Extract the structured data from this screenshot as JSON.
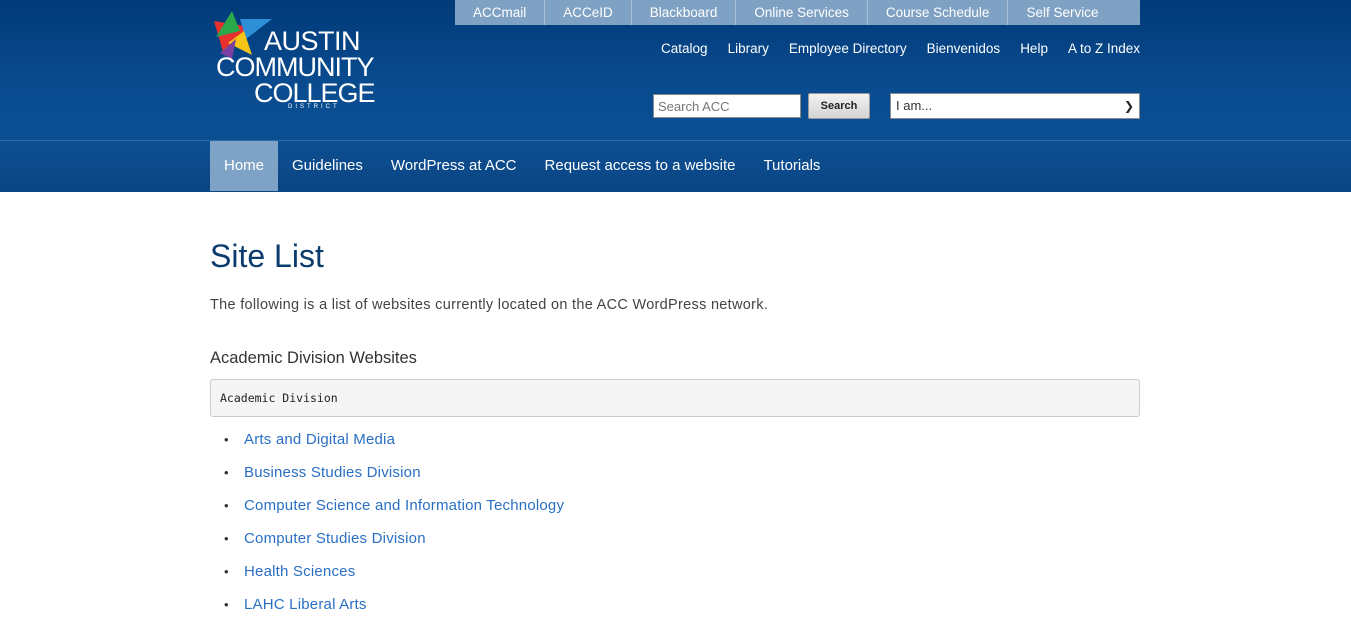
{
  "logo": {
    "line1": "AUSTIN",
    "line2": "COMMUNITY",
    "line3": "COLLEGE",
    "line4": "DISTRICT"
  },
  "utility_links": [
    "ACCmail",
    "ACCeID",
    "Blackboard",
    "Online Services",
    "Course Schedule",
    "Self Service"
  ],
  "secondary_links": [
    "Catalog",
    "Library",
    "Employee Directory",
    "Bienvenidos",
    "Help",
    "A to Z Index"
  ],
  "search": {
    "placeholder": "Search ACC",
    "button_label": "Search"
  },
  "audience_select": {
    "selected": "I am..."
  },
  "nav": {
    "items": [
      "Home",
      "Guidelines",
      "WordPress at ACC",
      "Request access to a website",
      "Tutorials"
    ],
    "active": "Home"
  },
  "main": {
    "title": "Site List",
    "intro": "The following is a list of websites currently located on the ACC WordPress network.",
    "section_heading": "Academic Division Websites",
    "code_box": "Academic Division",
    "sites": [
      "Arts and Digital Media",
      "Business Studies Division",
      "Computer Science and Information Technology",
      "Computer Studies Division",
      "Health Sciences",
      "LAHC Liberal Arts"
    ]
  },
  "colors": {
    "header_bg": "#003a78",
    "nav_active": "#7fa3c6",
    "link": "#2a6fc4",
    "title": "#0a3c6e"
  }
}
